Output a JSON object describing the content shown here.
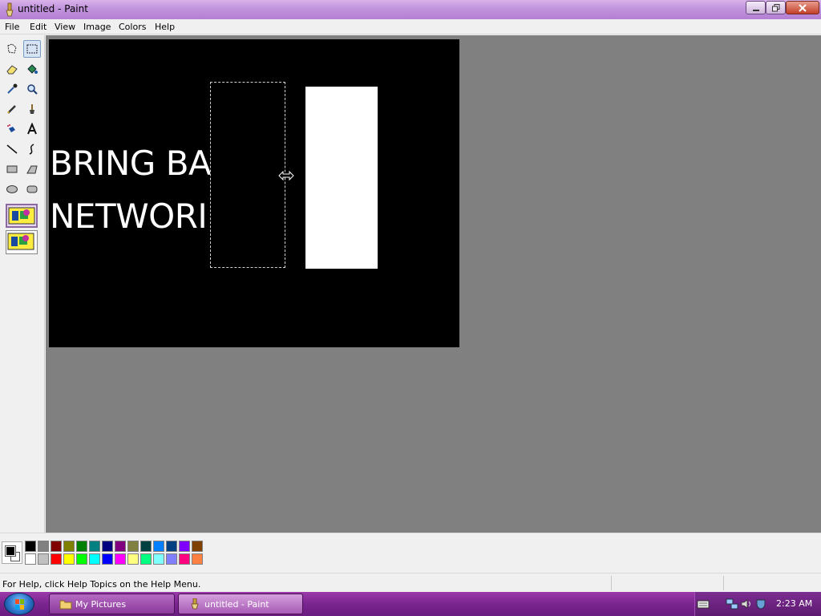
{
  "window": {
    "title": "untitled - Paint"
  },
  "menu": {
    "items": [
      "File",
      "Edit",
      "View",
      "Image",
      "Colors",
      "Help"
    ]
  },
  "toolbox": {
    "tools": [
      "free-form-select",
      "rectangle-select",
      "eraser",
      "fill-with-color",
      "pick-color",
      "magnifier",
      "pencil",
      "brush",
      "airbrush",
      "text",
      "line",
      "curve",
      "rectangle",
      "polygon",
      "ellipse",
      "rounded-rectangle"
    ],
    "selected_tool": "rectangle-select",
    "selection_mode": "opaque"
  },
  "canvas": {
    "background": "#000000",
    "text_line1": "BRING BA",
    "text_line2": "NETWORI",
    "cursor": "horizontal-resize"
  },
  "colors": {
    "foreground": "#000000",
    "background": "#ffffff",
    "palette_row1": [
      "#000000",
      "#808080",
      "#800000",
      "#808000",
      "#008000",
      "#008080",
      "#000080",
      "#800080",
      "#808040",
      "#004040",
      "#0080ff",
      "#004080",
      "#8000ff",
      "#804000"
    ],
    "palette_row2": [
      "#ffffff",
      "#c0c0c0",
      "#ff0000",
      "#ffff00",
      "#00ff00",
      "#00ffff",
      "#0000ff",
      "#ff00ff",
      "#ffff80",
      "#00ff80",
      "#80ffff",
      "#8080ff",
      "#ff0080",
      "#ff8040"
    ]
  },
  "status": {
    "help_text": "For Help, click Help Topics on the Help Menu."
  },
  "taskbar": {
    "buttons": [
      {
        "label": "My Pictures",
        "icon": "folder-icon"
      },
      {
        "label": "untitled - Paint",
        "icon": "paint-icon"
      }
    ],
    "clock": "2:23 AM"
  }
}
